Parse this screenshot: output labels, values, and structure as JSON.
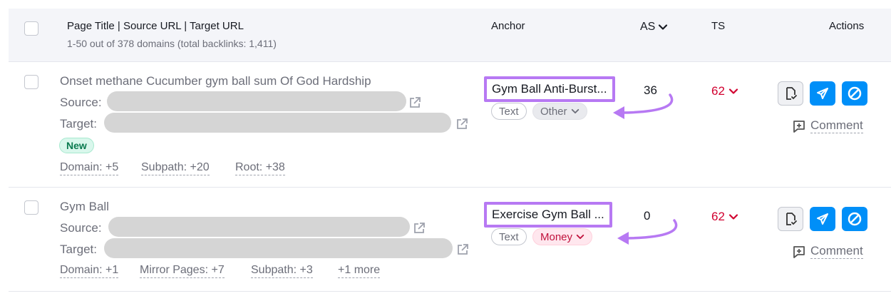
{
  "header": {
    "col_title": "Page Title | Source URL | Target URL",
    "col_title_sub": "1-50 out of 378 domains (total backlinks: 1,411)",
    "col_anchor": "Anchor",
    "col_as": "AS",
    "col_ts": "TS",
    "col_actions": "Actions"
  },
  "rows": [
    {
      "title": "Onset methane Cucumber gym ball sum Of God Hardship",
      "source_label": "Source:",
      "target_label": "Target:",
      "badge": "New",
      "links": [
        "Domain: +5",
        "Subpath: +20",
        "Root: +38"
      ],
      "anchor": "Gym Ball Anti-Burst...",
      "tag_type": "Text",
      "tag_category": "Other",
      "as": "36",
      "ts": "62",
      "comment": "Comment"
    },
    {
      "title": "Gym Ball",
      "source_label": "Source:",
      "target_label": "Target:",
      "links": [
        "Domain: +1",
        "Mirror Pages: +7",
        "Subpath: +3",
        "+1 more"
      ],
      "anchor": "Exercise Gym Ball ...",
      "tag_type": "Text",
      "tag_category": "Money",
      "as": "0",
      "ts": "62",
      "comment": "Comment"
    }
  ],
  "colors": {
    "highlight": "#b779f3",
    "ts_red": "#d1002f",
    "action_blue": "#008ff8",
    "new_green": "#0a7a4f"
  },
  "icons": [
    "external-link-icon",
    "chevron-down-icon",
    "export-doc-icon",
    "send-icon",
    "block-icon",
    "comment-plus-icon",
    "curved-arrow-icon"
  ]
}
